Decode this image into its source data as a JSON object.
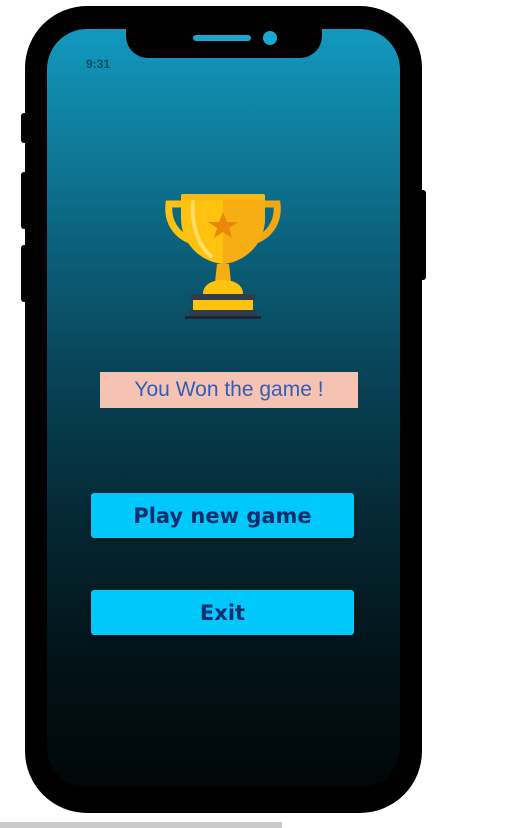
{
  "status_bar": {
    "time": "9:31"
  },
  "result": {
    "message": "You Won the game !"
  },
  "actions": {
    "play_new_game_label": "Play new game",
    "exit_label": "Exit"
  },
  "icons": {
    "trophy": "trophy-icon"
  },
  "colors": {
    "screen_top": "#1299c0",
    "screen_bottom": "#010709",
    "button_bg": "#00c8fb",
    "button_text": "#0c2e6e",
    "banner_bg": "#f6c3b2",
    "banner_text": "#2f5fb6",
    "trophy_gold": "#ffc20e"
  }
}
